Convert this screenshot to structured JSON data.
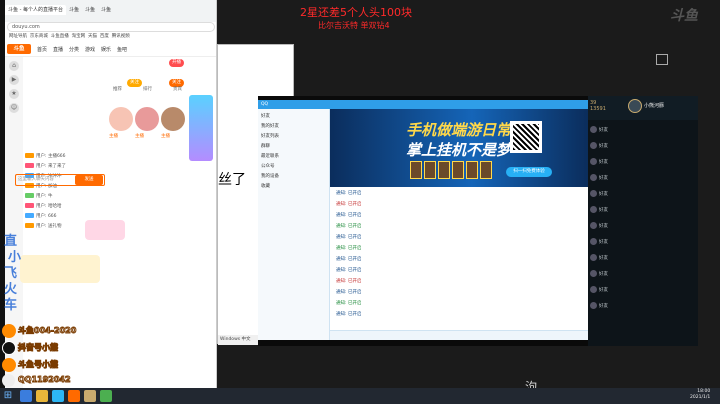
{
  "overlay": {
    "red_line1": "2星还差5个人头100块",
    "red_line2": "比尔吉沃特  单双钻4",
    "watermark": "斗鱼",
    "bottom_glyph": "泃",
    "blue_chars": [
      "直",
      "小",
      "飞",
      "火",
      "车"
    ]
  },
  "browser": {
    "tabs": [
      "斗鱼 - 每个人的直播平台",
      "斗鱼",
      "斗鱼",
      "斗鱼"
    ],
    "address": "douyu.com",
    "bookmarks": [
      "网址导航",
      "京东商城",
      "斗鱼直播",
      "淘宝网",
      "天猫",
      "百度",
      "腾讯视频"
    ],
    "site_logo": "斗鱼",
    "nav": [
      "首页",
      "直播",
      "分类",
      "游戏",
      "娱乐",
      "鱼吧"
    ],
    "pill_top": "开播",
    "pill_follow": "关注",
    "sub_tabs": [
      "推荐",
      "排行",
      "贵宾"
    ],
    "card_labels": [
      "主播",
      "主播",
      "主播"
    ],
    "chat_lines": [
      "用户: 主播666",
      "用户: 来了来了",
      "用户: 冲冲冲",
      "用户: 加油",
      "用户: 牛",
      "用户: 哈哈哈",
      "用户: 666",
      "用户: 送礼物"
    ],
    "chat_placeholder": "这里输入聊天内容",
    "send_label": "发送"
  },
  "doc": {
    "text": "丝了",
    "status": "Windows 中文"
  },
  "qq": {
    "title": "QQ",
    "left_items": [
      "好友",
      "我的好友",
      "好友列表",
      "群聊",
      "最近联系",
      "公众号",
      "我的设备",
      "收藏"
    ],
    "banner_line1": "手机做端游日常",
    "banner_line2": "掌上挂机不是梦",
    "banner_button": "扫一扫免费体验",
    "messages": [
      "通知: 已开启",
      "通知: 已开启",
      "通知: 已开启",
      "通知: 已开启",
      "通知: 已开启",
      "通知: 已开启",
      "通知: 已开启",
      "通知: 已开启",
      "通知: 已开启",
      "通知: 已开启",
      "通知: 已开启",
      "通知: 已开启"
    ]
  },
  "game": {
    "coins": "39",
    "rp": "13591",
    "name": "小熊河豚",
    "friends": [
      "好友",
      "好友",
      "好友",
      "好友",
      "好友",
      "好友",
      "好友",
      "好友",
      "好友",
      "好友",
      "好友",
      "好友"
    ]
  },
  "social": [
    "斗鱼004-2020",
    "抖音号小熊",
    "斗鱼号小熊",
    "QQ1192042"
  ],
  "taskbar": {
    "clock_time": "18:00",
    "clock_date": "2021/1/1"
  },
  "colors": {
    "accent": "#ff6a00",
    "qq_blue": "#2f9ee8",
    "overlay_red": "#ff2a2a"
  }
}
